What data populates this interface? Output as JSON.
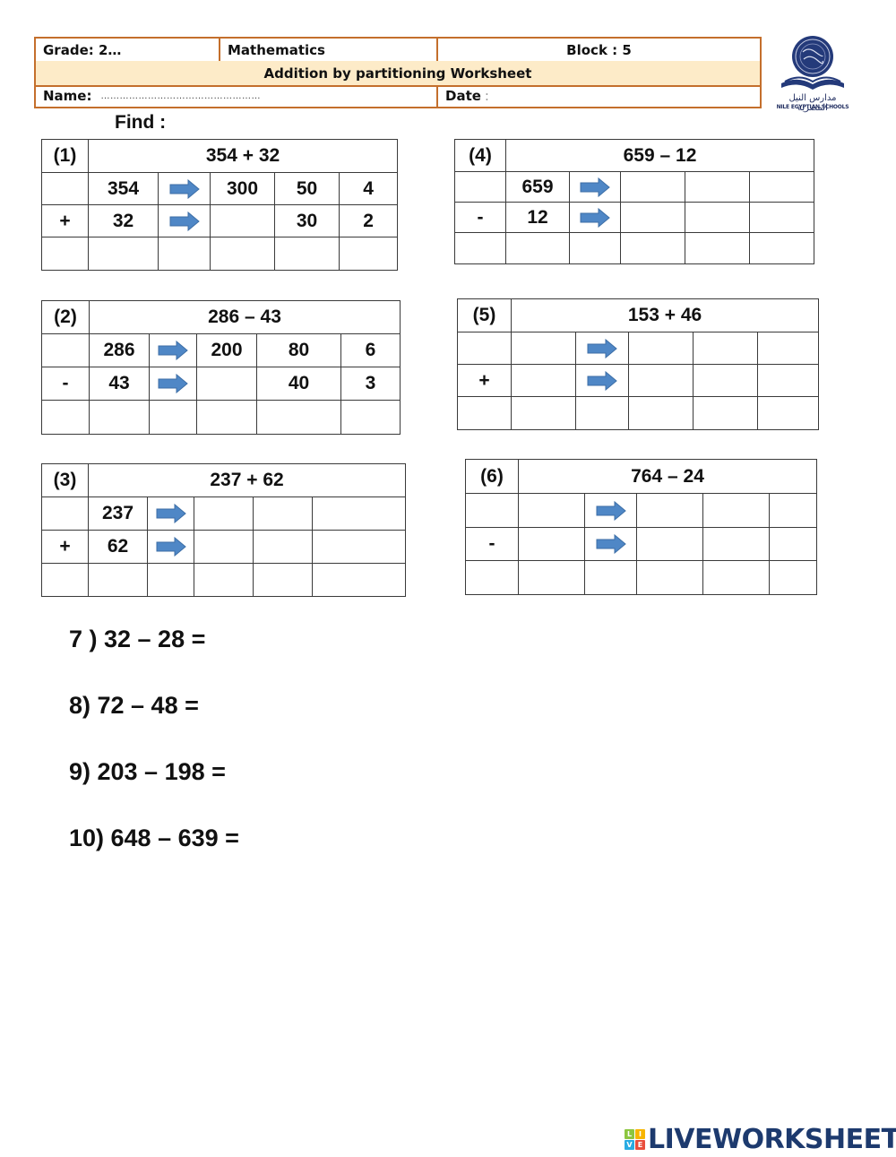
{
  "header": {
    "grade": "Grade: 2…",
    "subject": "Mathematics",
    "block": "Block : 5",
    "title": "Addition by partitioning Worksheet",
    "name_label": "Name:",
    "name_dots": "……………………………………………",
    "date_label": "Date",
    "date_colon": ":"
  },
  "logo": {
    "arabic": "مدارس النيل المصرية",
    "english": "NILE EGYPTIAN SCHOOLS"
  },
  "find_label": "Find :",
  "problems": [
    {
      "number": "(1)",
      "expression": "354 + 32",
      "operator": "+",
      "row1": [
        "354",
        "300",
        "50",
        "4"
      ],
      "row2": [
        "32",
        "",
        "30",
        "2"
      ]
    },
    {
      "number": "(2)",
      "expression": "286 – 43",
      "operator": "-",
      "row1": [
        "286",
        "200",
        "80",
        "6"
      ],
      "row2": [
        "43",
        "",
        "40",
        "3"
      ]
    },
    {
      "number": "(3)",
      "expression": "237 + 62",
      "operator": "+",
      "row1": [
        "237",
        "",
        "",
        ""
      ],
      "row2": [
        "62",
        "",
        "",
        ""
      ]
    },
    {
      "number": "(4)",
      "expression": "659 – 12",
      "operator": "-",
      "row1": [
        "659",
        "",
        "",
        ""
      ],
      "row2": [
        "12",
        "",
        "",
        ""
      ]
    },
    {
      "number": "(5)",
      "expression": "153 + 46",
      "operator": "+",
      "row1": [
        "",
        "",
        "",
        ""
      ],
      "row2": [
        "",
        "",
        "",
        ""
      ]
    },
    {
      "number": "(6)",
      "expression": "764 – 24",
      "operator": "-",
      "row1": [
        "",
        "",
        "",
        ""
      ],
      "row2": [
        "",
        "",
        "",
        ""
      ]
    }
  ],
  "equations": [
    "7 ) 32 – 28 =",
    "8) 72 – 48 =",
    "9) 203 – 198 =",
    "10) 648 – 639 ="
  ],
  "colors": {
    "header_border": "#c46f2c",
    "header_band": "#fdebc8",
    "arrow_fill": "#4f87c6",
    "brand": "#1d3a6e"
  },
  "brand": {
    "badge_letters": [
      "L",
      "I",
      "V",
      "E"
    ],
    "name": "LIVEWORKSHEETS"
  }
}
